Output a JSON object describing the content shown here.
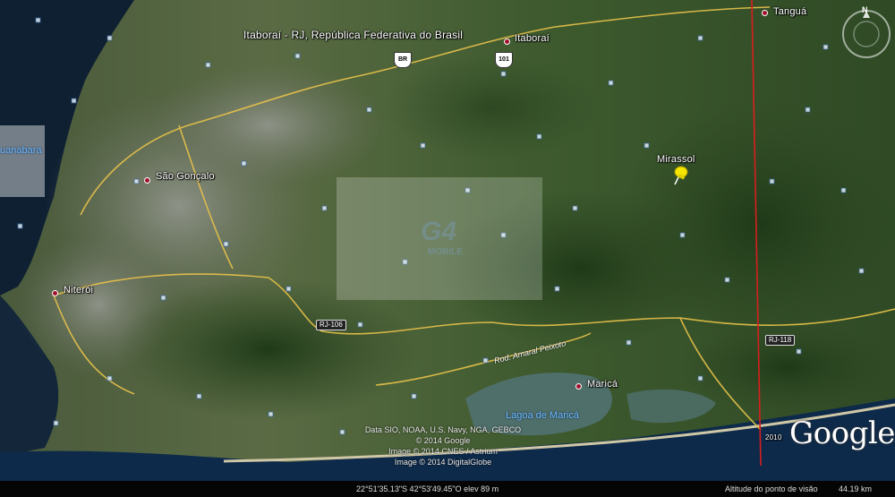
{
  "map": {
    "region_label": "Itaboraí - RJ, República Federativa do Brasil",
    "places": {
      "tangua": "Tanguá",
      "itaborai": "Itaboraí",
      "sao_goncalo": "São Gonçalo",
      "niteroi": "Niterói",
      "marica": "Maricá",
      "mirassol": "Mirassol",
      "guanabara": "uanabara",
      "lagoa_marica": "Lagoa de Maricá"
    },
    "roads": {
      "br_top": "BR",
      "shield_top": "101",
      "rj106": "RJ-106",
      "rj118": "RJ-118",
      "rod_peixoto": "Rod. Amaral Peixoto"
    },
    "watermark": {
      "title": "G4",
      "subtitle": "MOBILE"
    },
    "credits": [
      "Data SIO, NOAA, U.S. Navy, NGA, GEBCO",
      "© 2014 Google",
      "Image © 2014 CNES / Astrium",
      "Image © 2014 DigitalGlobe"
    ],
    "year_label": "2010",
    "logo": "Google",
    "colors": {
      "roads": "#e8c24a",
      "border_line": "#d81e1e",
      "place_dot": "#a0102a",
      "water_label": "#6fb8ff",
      "pin": "#f6e600"
    },
    "icons": {
      "pin": "pushpin-icon",
      "compass": "compass-icon"
    }
  },
  "status": {
    "coords": "22°51'35.13\"S  42°53'49.45\"O  elev  89 m",
    "altitude_label": "Altitude do ponto de visão",
    "altitude_value": "44.19 km"
  }
}
